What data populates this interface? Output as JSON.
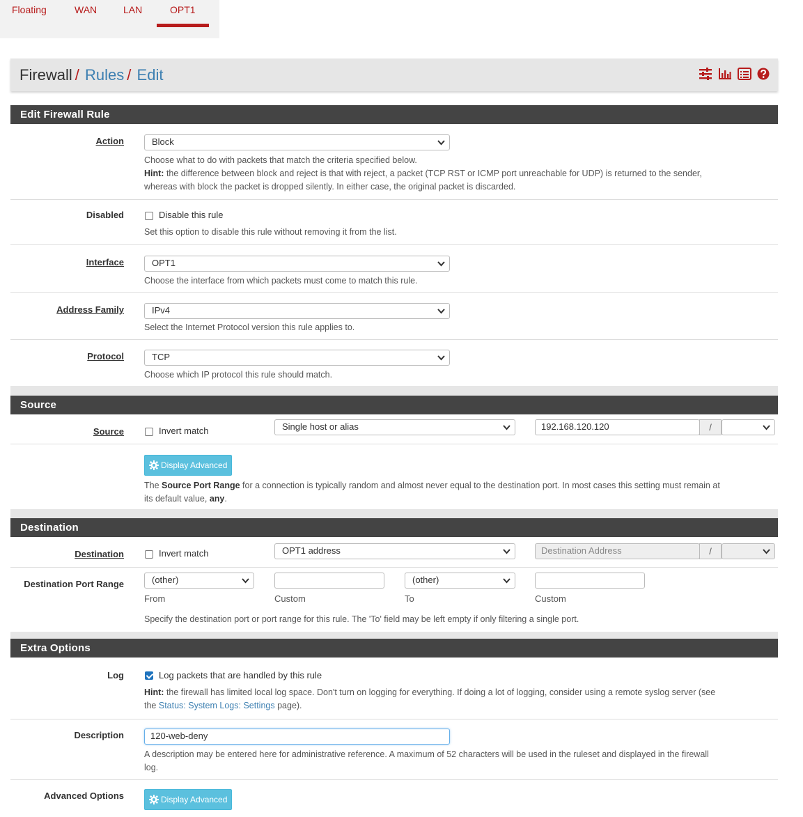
{
  "tabs": [
    {
      "label": "Floating"
    },
    {
      "label": "WAN"
    },
    {
      "label": "LAN"
    },
    {
      "label": "OPT1",
      "active": true
    }
  ],
  "breadcrumb": {
    "root": "Firewall",
    "sep": "/",
    "rules": "Rules",
    "edit": "Edit"
  },
  "header_icons": [
    "sliders-icon",
    "chart-icon",
    "list-icon",
    "help-icon"
  ],
  "colors": {
    "accent": "#b71c1c",
    "link": "#3c7fb1",
    "panel_head": "#444444",
    "info_button": "#5bc0de"
  },
  "edit_rule": {
    "title": "Edit Firewall Rule",
    "action": {
      "label": "Action",
      "value": "Block",
      "help": "Choose what to do with packets that match the criteria specified below.",
      "hint_prefix": "Hint:",
      "hint": " the difference between block and reject is that with reject, a packet (TCP RST or ICMP port unreachable for UDP) is returned to the sender,",
      "hint2": "whereas with block the packet is dropped silently. In either case, the original packet is discarded."
    },
    "disabled": {
      "label": "Disabled",
      "checkbox_label": "Disable this rule",
      "checked": false,
      "help": "Set this option to disable this rule without removing it from the list."
    },
    "interface": {
      "label": "Interface",
      "value": "OPT1",
      "help": "Choose the interface from which packets must come to match this rule."
    },
    "address_family": {
      "label": "Address Family",
      "value": "IPv4",
      "help": "Select the Internet Protocol version this rule applies to."
    },
    "protocol": {
      "label": "Protocol",
      "value": "TCP",
      "help": "Choose which IP protocol this rule should match."
    }
  },
  "source": {
    "title": "Source",
    "label": "Source",
    "invert_label": "Invert match",
    "invert_checked": false,
    "type": "Single host or alias",
    "address": "192.168.120.120",
    "slash": "/",
    "mask": "",
    "advanced_button": "Display Advanced",
    "help_pre": "The ",
    "help_bold": "Source Port Range",
    "help_post": " for a connection is typically random and almost never equal to the destination port. In most cases this setting must remain at",
    "help_line2_pre": "its default value, ",
    "help_line2_bold": "any",
    "help_line2_post": "."
  },
  "destination": {
    "title": "Destination",
    "label": "Destination",
    "invert_label": "Invert match",
    "invert_checked": false,
    "type": "OPT1 address",
    "address_placeholder": "Destination Address",
    "slash": "/",
    "port_range": {
      "label": "Destination Port Range",
      "from_value": "(other)",
      "from_custom": "",
      "to_value": "(other)",
      "to_custom": "",
      "from_label": "From",
      "custom_label": "Custom",
      "to_label": "To",
      "custom_label2": "Custom",
      "help": "Specify the destination port or port range for this rule. The 'To' field may be left empty if only filtering a single port."
    }
  },
  "extra": {
    "title": "Extra Options",
    "log": {
      "label": "Log",
      "checkbox_label": "Log packets that are handled by this rule",
      "checked": true,
      "hint_prefix": "Hint:",
      "hint": " the firewall has limited local log space. Don't turn on logging for everything. If doing a lot of logging, consider using a remote syslog server (see",
      "hint2_pre": "the ",
      "hint2_link": "Status: System Logs: Settings",
      "hint2_post": " page)."
    },
    "description": {
      "label": "Description",
      "value": "120-web-deny",
      "help": "A description may be entered here for administrative reference. A maximum of 52 characters will be used in the ruleset and displayed in the firewall",
      "help2": "log."
    },
    "advanced": {
      "label": "Advanced Options",
      "button": "Display Advanced"
    }
  }
}
